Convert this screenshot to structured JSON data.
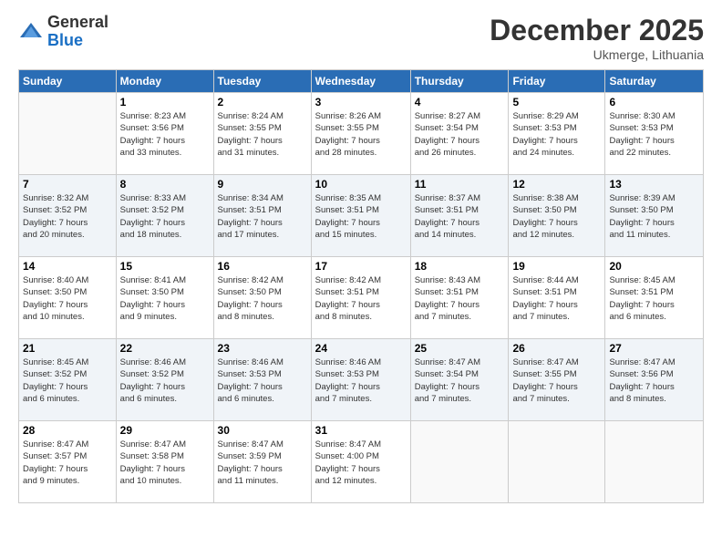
{
  "logo": {
    "general": "General",
    "blue": "Blue"
  },
  "title": "December 2025",
  "location": "Ukmerge, Lithuania",
  "days_of_week": [
    "Sunday",
    "Monday",
    "Tuesday",
    "Wednesday",
    "Thursday",
    "Friday",
    "Saturday"
  ],
  "weeks": [
    [
      {
        "day": "",
        "info": ""
      },
      {
        "day": "1",
        "info": "Sunrise: 8:23 AM\nSunset: 3:56 PM\nDaylight: 7 hours\nand 33 minutes."
      },
      {
        "day": "2",
        "info": "Sunrise: 8:24 AM\nSunset: 3:55 PM\nDaylight: 7 hours\nand 31 minutes."
      },
      {
        "day": "3",
        "info": "Sunrise: 8:26 AM\nSunset: 3:55 PM\nDaylight: 7 hours\nand 28 minutes."
      },
      {
        "day": "4",
        "info": "Sunrise: 8:27 AM\nSunset: 3:54 PM\nDaylight: 7 hours\nand 26 minutes."
      },
      {
        "day": "5",
        "info": "Sunrise: 8:29 AM\nSunset: 3:53 PM\nDaylight: 7 hours\nand 24 minutes."
      },
      {
        "day": "6",
        "info": "Sunrise: 8:30 AM\nSunset: 3:53 PM\nDaylight: 7 hours\nand 22 minutes."
      }
    ],
    [
      {
        "day": "7",
        "info": "Sunrise: 8:32 AM\nSunset: 3:52 PM\nDaylight: 7 hours\nand 20 minutes."
      },
      {
        "day": "8",
        "info": "Sunrise: 8:33 AM\nSunset: 3:52 PM\nDaylight: 7 hours\nand 18 minutes."
      },
      {
        "day": "9",
        "info": "Sunrise: 8:34 AM\nSunset: 3:51 PM\nDaylight: 7 hours\nand 17 minutes."
      },
      {
        "day": "10",
        "info": "Sunrise: 8:35 AM\nSunset: 3:51 PM\nDaylight: 7 hours\nand 15 minutes."
      },
      {
        "day": "11",
        "info": "Sunrise: 8:37 AM\nSunset: 3:51 PM\nDaylight: 7 hours\nand 14 minutes."
      },
      {
        "day": "12",
        "info": "Sunrise: 8:38 AM\nSunset: 3:50 PM\nDaylight: 7 hours\nand 12 minutes."
      },
      {
        "day": "13",
        "info": "Sunrise: 8:39 AM\nSunset: 3:50 PM\nDaylight: 7 hours\nand 11 minutes."
      }
    ],
    [
      {
        "day": "14",
        "info": "Sunrise: 8:40 AM\nSunset: 3:50 PM\nDaylight: 7 hours\nand 10 minutes."
      },
      {
        "day": "15",
        "info": "Sunrise: 8:41 AM\nSunset: 3:50 PM\nDaylight: 7 hours\nand 9 minutes."
      },
      {
        "day": "16",
        "info": "Sunrise: 8:42 AM\nSunset: 3:50 PM\nDaylight: 7 hours\nand 8 minutes."
      },
      {
        "day": "17",
        "info": "Sunrise: 8:42 AM\nSunset: 3:51 PM\nDaylight: 7 hours\nand 8 minutes."
      },
      {
        "day": "18",
        "info": "Sunrise: 8:43 AM\nSunset: 3:51 PM\nDaylight: 7 hours\nand 7 minutes."
      },
      {
        "day": "19",
        "info": "Sunrise: 8:44 AM\nSunset: 3:51 PM\nDaylight: 7 hours\nand 7 minutes."
      },
      {
        "day": "20",
        "info": "Sunrise: 8:45 AM\nSunset: 3:51 PM\nDaylight: 7 hours\nand 6 minutes."
      }
    ],
    [
      {
        "day": "21",
        "info": "Sunrise: 8:45 AM\nSunset: 3:52 PM\nDaylight: 7 hours\nand 6 minutes."
      },
      {
        "day": "22",
        "info": "Sunrise: 8:46 AM\nSunset: 3:52 PM\nDaylight: 7 hours\nand 6 minutes."
      },
      {
        "day": "23",
        "info": "Sunrise: 8:46 AM\nSunset: 3:53 PM\nDaylight: 7 hours\nand 6 minutes."
      },
      {
        "day": "24",
        "info": "Sunrise: 8:46 AM\nSunset: 3:53 PM\nDaylight: 7 hours\nand 7 minutes."
      },
      {
        "day": "25",
        "info": "Sunrise: 8:47 AM\nSunset: 3:54 PM\nDaylight: 7 hours\nand 7 minutes."
      },
      {
        "day": "26",
        "info": "Sunrise: 8:47 AM\nSunset: 3:55 PM\nDaylight: 7 hours\nand 7 minutes."
      },
      {
        "day": "27",
        "info": "Sunrise: 8:47 AM\nSunset: 3:56 PM\nDaylight: 7 hours\nand 8 minutes."
      }
    ],
    [
      {
        "day": "28",
        "info": "Sunrise: 8:47 AM\nSunset: 3:57 PM\nDaylight: 7 hours\nand 9 minutes."
      },
      {
        "day": "29",
        "info": "Sunrise: 8:47 AM\nSunset: 3:58 PM\nDaylight: 7 hours\nand 10 minutes."
      },
      {
        "day": "30",
        "info": "Sunrise: 8:47 AM\nSunset: 3:59 PM\nDaylight: 7 hours\nand 11 minutes."
      },
      {
        "day": "31",
        "info": "Sunrise: 8:47 AM\nSunset: 4:00 PM\nDaylight: 7 hours\nand 12 minutes."
      },
      {
        "day": "",
        "info": ""
      },
      {
        "day": "",
        "info": ""
      },
      {
        "day": "",
        "info": ""
      }
    ]
  ]
}
